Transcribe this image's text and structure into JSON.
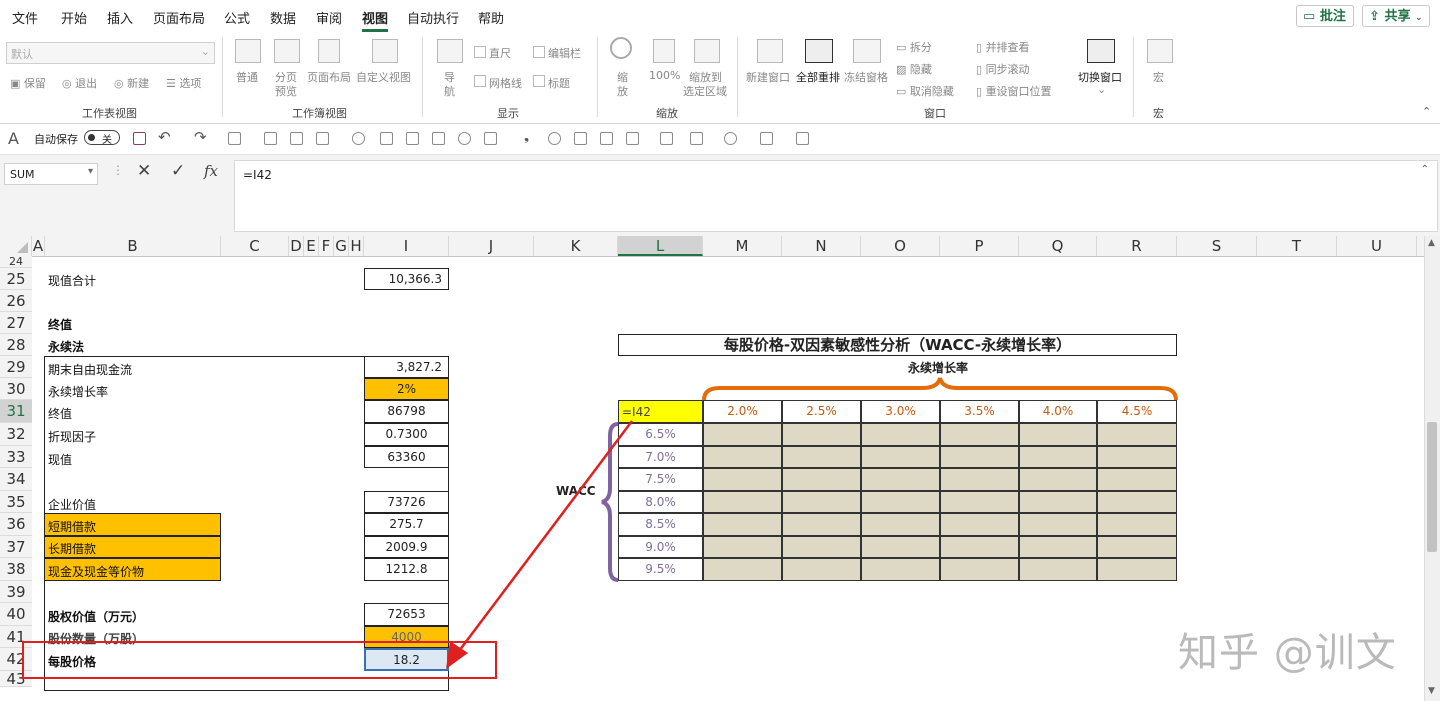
{
  "menu": {
    "items": [
      "文件",
      "开始",
      "插入",
      "页面布局",
      "公式",
      "数据",
      "审阅",
      "视图",
      "自动执行",
      "帮助"
    ],
    "active": "视图",
    "comment_button": "批注",
    "share_button": "共享"
  },
  "ribbon": {
    "view_dropdown": "默认",
    "workbook_views": {
      "keep": "保留",
      "exit": "退出",
      "new": "新建",
      "options": "选项",
      "group": "工作表视图"
    },
    "workbook": {
      "normal": "普通",
      "page_break_1": "分页",
      "page_break_2": "预览",
      "page_layout": "页面布局",
      "custom": "自定义视图",
      "group": "工作簿视图"
    },
    "show": {
      "nav_1": "导",
      "nav_2": "航",
      "ruler": "直尺",
      "formula_bar": "编辑栏",
      "gridlines": "网格线",
      "headings": "标题",
      "group": "显示"
    },
    "zoom": {
      "zoom_1": "缩",
      "zoom_2": "放",
      "hundred": "100%",
      "to_sel_1": "缩放到",
      "to_sel_2": "选定区域",
      "group": "缩放"
    },
    "window": {
      "new_window": "新建窗口",
      "arrange_all": "全部重排",
      "freeze": "冻结窗格",
      "split": "拆分",
      "hide": "隐藏",
      "unhide": "取消隐藏",
      "side_by_side": "并排查看",
      "sync_scroll": "同步滚动",
      "reset_pos": "重设窗口位置",
      "switch": "切换窗口",
      "group": "窗口"
    },
    "macros": {
      "macro": "宏",
      "group": "宏"
    }
  },
  "qat": {
    "autosave": "自动保存",
    "toggle": "关"
  },
  "formula_bar": {
    "name_box": "SUM",
    "formula": "=I42",
    "fx": "fx"
  },
  "columns": [
    "A",
    "B",
    "C",
    "D",
    "E",
    "F",
    "G",
    "H",
    "I",
    "J",
    "K",
    "L",
    "M",
    "N",
    "O",
    "P",
    "Q",
    "R",
    "S",
    "T",
    "U"
  ],
  "rows": [
    "24",
    "25",
    "26",
    "27",
    "28",
    "29",
    "30",
    "31",
    "32",
    "33",
    "34",
    "35",
    "36",
    "37",
    "38",
    "39",
    "40",
    "41",
    "42",
    "43"
  ],
  "model": {
    "pv_total_label": "现值合计",
    "pv_total_value": "10,366.3",
    "terminal_label": "终值",
    "perpetuity_label": "永续法",
    "lines": [
      {
        "label": "期末自由现金流",
        "value": "3,827.2"
      },
      {
        "label": "永续增长率",
        "value": "2%"
      },
      {
        "label": "终值",
        "value": "86798"
      },
      {
        "label": "折现因子",
        "value": "0.7300"
      },
      {
        "label": "现值",
        "value": "63360"
      },
      {
        "label": "企业价值",
        "value": "73726"
      },
      {
        "label": "短期借款",
        "value": "275.7"
      },
      {
        "label": "长期借款",
        "value": "2009.9"
      },
      {
        "label": "现金及现金等价物",
        "value": "1212.8"
      },
      {
        "label": "股权价值（万元）",
        "value": "72653"
      },
      {
        "label": "股份数量（万股）",
        "value": "4000"
      },
      {
        "label": "每股价格",
        "value": "18.2"
      }
    ]
  },
  "sensitivity": {
    "title": "每股价格-双因素敏感性分析（WACC-永续增长率）",
    "growth_label": "永续增长率",
    "wacc_label": "WACC",
    "corner": "=I42",
    "growth_rates": [
      "2.0%",
      "2.5%",
      "3.0%",
      "3.5%",
      "4.0%",
      "4.5%"
    ],
    "wacc_rates": [
      "6.5%",
      "7.0%",
      "7.5%",
      "8.0%",
      "8.5%",
      "9.0%",
      "9.5%"
    ]
  },
  "watermark": "知乎 @训文",
  "colors": {
    "excel_green": "#217346",
    "orange_fill": "#ffc000",
    "tan_fill": "#ddd9c4",
    "brace_orange": "#e46c0a",
    "brace_purple": "#8064a2",
    "annotation_red": "#e02020"
  }
}
